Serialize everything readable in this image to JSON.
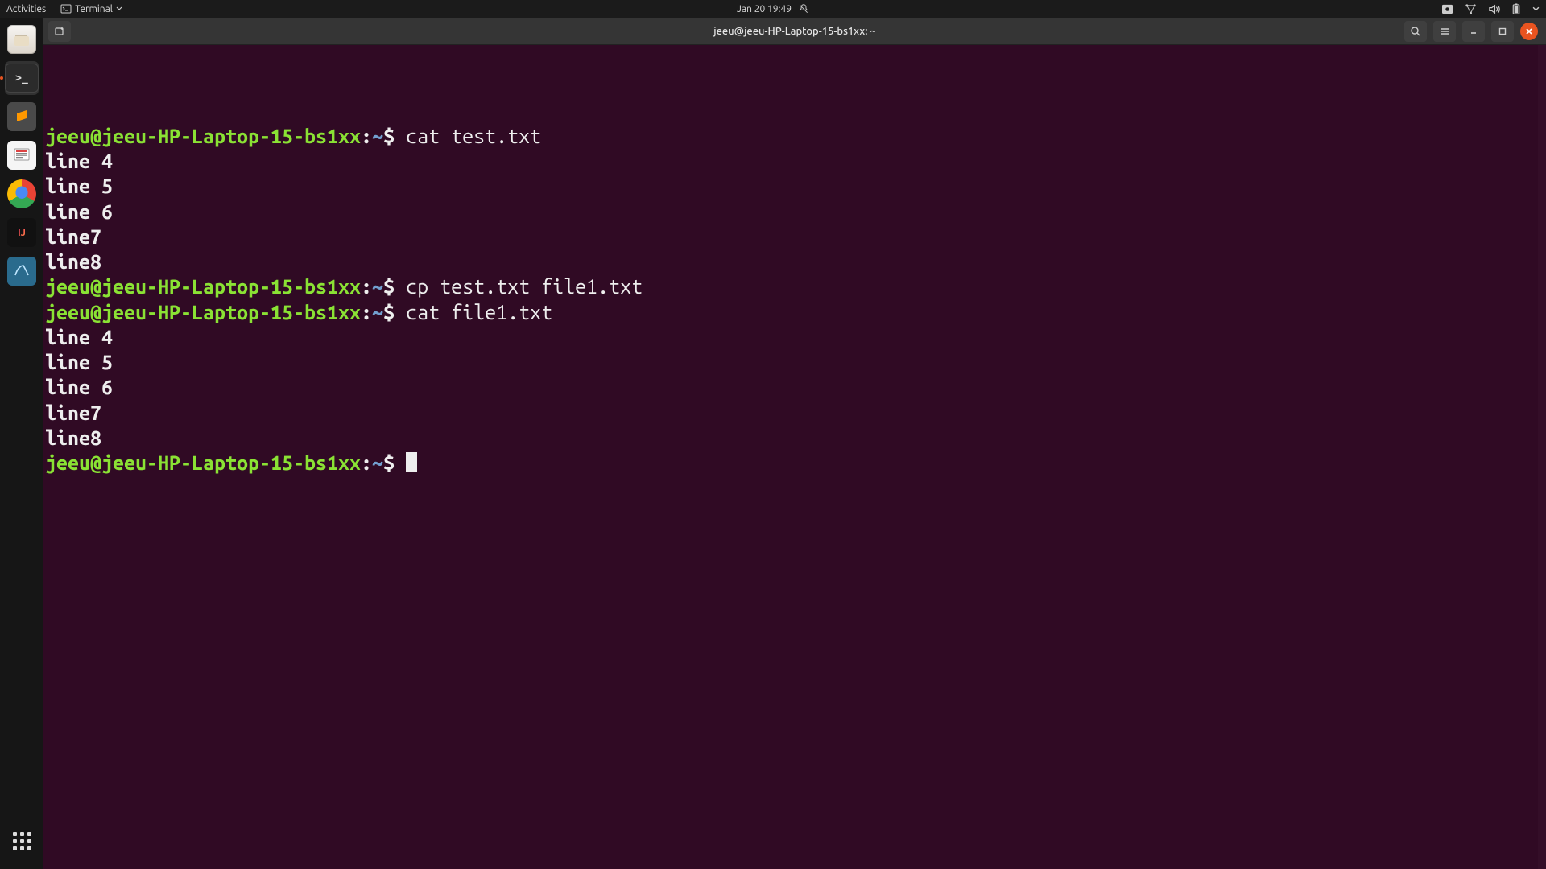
{
  "topbar": {
    "activities": "Activities",
    "app_menu": "Terminal",
    "clock": "Jan 20  19:49"
  },
  "dock": {
    "items": [
      {
        "name": "files",
        "label": "Files"
      },
      {
        "name": "terminal",
        "label": "Terminal",
        "active": true
      },
      {
        "name": "sublime",
        "label": "Sublime Text"
      },
      {
        "name": "reader",
        "label": "Document Viewer"
      },
      {
        "name": "chrome",
        "label": "Google Chrome"
      },
      {
        "name": "intellij",
        "label": "IntelliJ IDEA"
      },
      {
        "name": "mysql",
        "label": "MySQL Workbench"
      }
    ]
  },
  "window": {
    "title": "jeeu@jeeu-HP-Laptop-15-bs1xx: ~"
  },
  "prompt": {
    "user_host": "jeeu@jeeu-HP-Laptop-15-bs1xx",
    "sep": ":",
    "path": "~",
    "symbol": "$"
  },
  "session": [
    {
      "type": "cmd",
      "text": "cat test.txt"
    },
    {
      "type": "out",
      "text": "line 4"
    },
    {
      "type": "out",
      "text": "line 5"
    },
    {
      "type": "out",
      "text": "line 6"
    },
    {
      "type": "out",
      "text": "line7"
    },
    {
      "type": "out",
      "text": "line8"
    },
    {
      "type": "cmd",
      "text": "cp test.txt file1.txt"
    },
    {
      "type": "cmd",
      "text": "cat file1.txt"
    },
    {
      "type": "out",
      "text": "line 4"
    },
    {
      "type": "out",
      "text": "line 5"
    },
    {
      "type": "out",
      "text": "line 6"
    },
    {
      "type": "out",
      "text": "line7"
    },
    {
      "type": "out",
      "text": "line8"
    },
    {
      "type": "cursor"
    }
  ]
}
